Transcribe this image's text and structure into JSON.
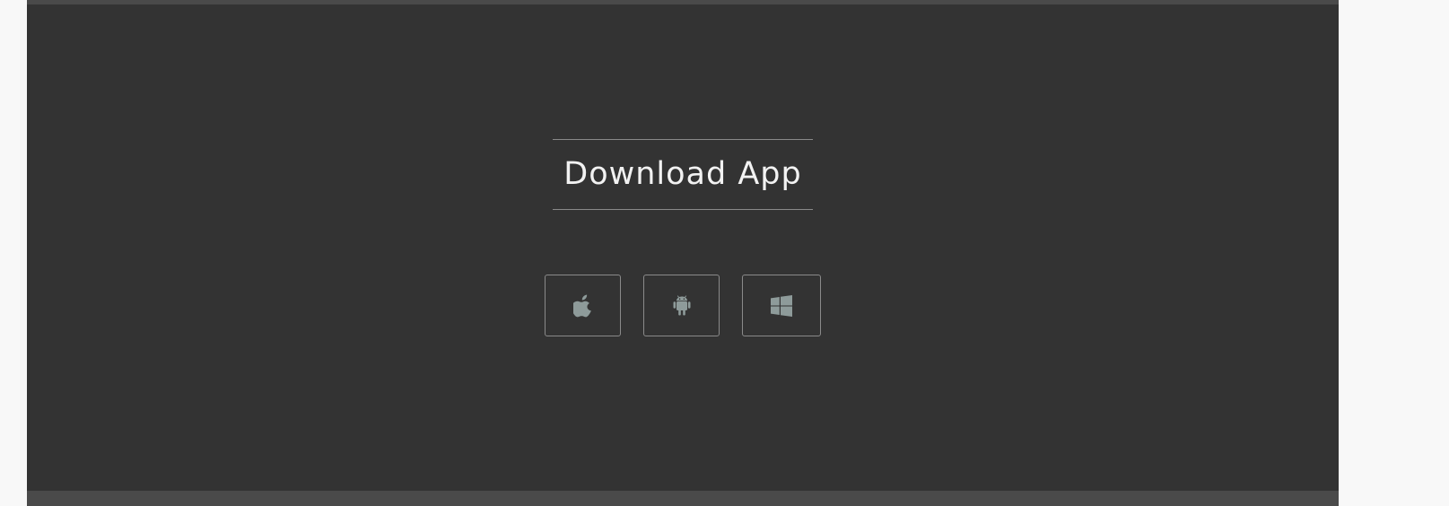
{
  "section": {
    "title": "Download App"
  },
  "store_buttons": [
    {
      "platform": "apple",
      "icon": "apple-icon"
    },
    {
      "platform": "android",
      "icon": "android-icon"
    },
    {
      "platform": "windows",
      "icon": "windows-icon"
    }
  ],
  "colors": {
    "page_background": "#f8f8f8",
    "section_background": "#333333",
    "strip": "#4a4a4a",
    "heading_text": "#f2f2f2",
    "rule_and_border": "#8a8a8a",
    "icon": "#8e9b9a"
  }
}
